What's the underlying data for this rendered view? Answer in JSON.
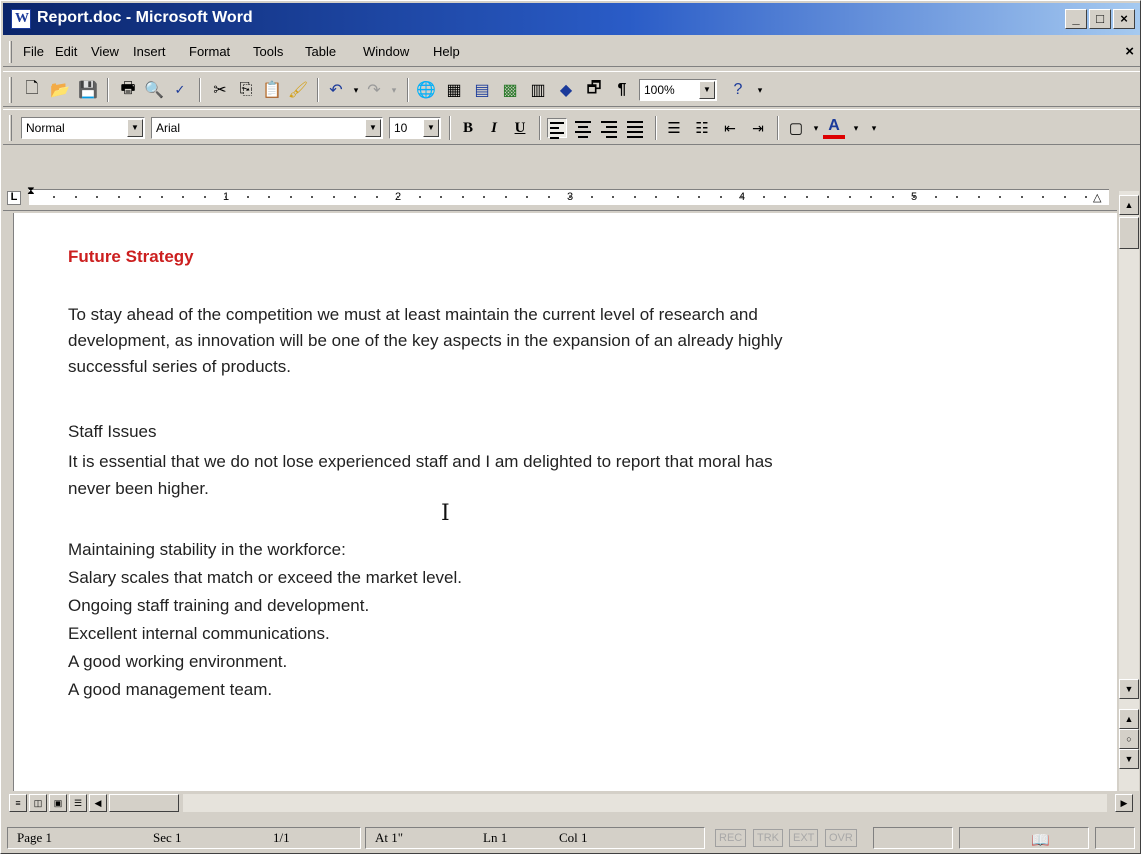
{
  "window": {
    "title": "Report.doc - Microsoft Word"
  },
  "menu": [
    "File",
    "Edit",
    "View",
    "Insert",
    "Format",
    "Tools",
    "Table",
    "Window",
    "Help"
  ],
  "toolbar": {
    "zoom": "100%"
  },
  "format": {
    "style": "Normal",
    "font": "Arial",
    "size": "10",
    "bold": "B",
    "italic": "I",
    "underline": "U"
  },
  "ruler": [
    "1",
    "2",
    "3",
    "4",
    "5"
  ],
  "document": {
    "heading": "Future Strategy",
    "para1": [
      "To stay ahead of the competition we must at least maintain the current level of research and",
      "development, as innovation will be one of the key aspects in the expansion of an already highly",
      "successful series of products."
    ],
    "staff_heading": "Staff Issues",
    "para2": [
      "It is essential that we do not lose experienced staff and I am delighted to report that moral has",
      "never been higher."
    ],
    "list": [
      "Maintaining stability in the workforce:",
      "Salary scales that match or exceed the market level.",
      "Ongoing staff training and development.",
      "Excellent internal communications.",
      "A good working environment.",
      "A good management team."
    ]
  },
  "status": {
    "page": "Page 1",
    "sec": "Sec 1",
    "pages": "1/1",
    "at": "At 1\"",
    "ln": "Ln 1",
    "col": "Col 1",
    "rec": "REC",
    "trk": "TRK",
    "ext": "EXT",
    "ovr": "OVR"
  }
}
